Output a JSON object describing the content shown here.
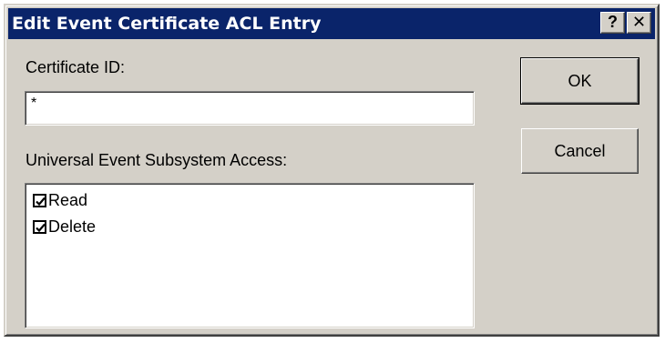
{
  "window": {
    "title": "Edit Event Certificate ACL Entry",
    "help_label": "?",
    "close_label": "✕"
  },
  "certificate": {
    "label": "Certificate ID:",
    "value": "*"
  },
  "access": {
    "label": "Universal Event Subsystem Access:",
    "items": [
      {
        "label": "Read",
        "checked": true
      },
      {
        "label": "Delete",
        "checked": true
      }
    ]
  },
  "buttons": {
    "ok_label": "OK",
    "cancel_label": "Cancel"
  },
  "colors": {
    "titlebar": "#0a246a",
    "dialog_face": "#d4d0c8"
  }
}
